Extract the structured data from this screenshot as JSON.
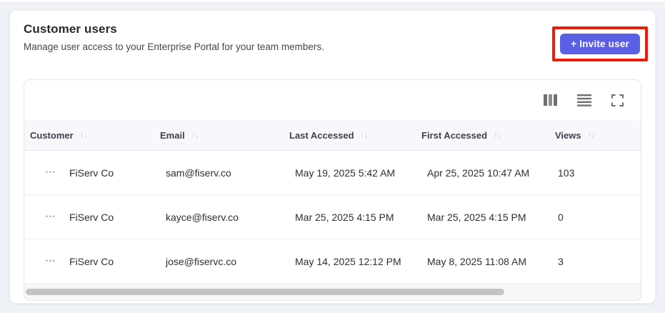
{
  "page": {
    "title": "Customer users",
    "subtitle": "Manage user access to your Enterprise Portal for your team members."
  },
  "invite_button": {
    "label": "+ Invite user"
  },
  "toolbar": {
    "icons": [
      "columns-icon",
      "row-density-icon",
      "fullscreen-icon"
    ]
  },
  "table": {
    "sort_icon_glyph": "↑↓",
    "row_actions_glyph": "•••",
    "columns": [
      {
        "label": "Customer"
      },
      {
        "label": "Email"
      },
      {
        "label": "Last Accessed"
      },
      {
        "label": "First Accessed"
      },
      {
        "label": "Views"
      }
    ],
    "rows": [
      {
        "customer": "FiServ Co",
        "email": "sam@fiserv.co",
        "last_accessed": "May 19, 2025 5:42 AM",
        "first_accessed": "Apr 25, 2025 10:47 AM",
        "views": "103"
      },
      {
        "customer": "FiServ Co",
        "email": "kayce@fiserv.co",
        "last_accessed": "Mar 25, 2025 4:15 PM",
        "first_accessed": "Mar 25, 2025 4:15 PM",
        "views": "0"
      },
      {
        "customer": "FiServ Co",
        "email": "jose@fiservc.co",
        "last_accessed": "May 14, 2025 12:12 PM",
        "first_accessed": "May 8, 2025 11:08 AM",
        "views": "3"
      }
    ]
  },
  "colors": {
    "accent_button": "#5b5fe3",
    "annotation_highlight": "#ee1d0b",
    "header_row_bg": "#f8f8fc",
    "page_bg": "#eef2f6"
  }
}
